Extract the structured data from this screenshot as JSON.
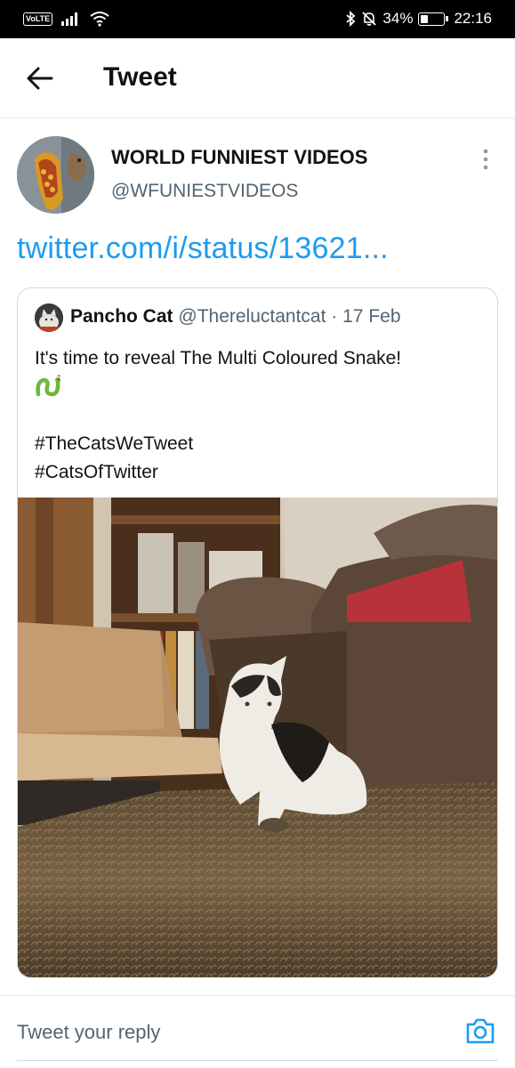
{
  "status_bar": {
    "volte_label": "VoLTE",
    "battery_percent": "34%",
    "battery_level": 0.34,
    "time": "22:16",
    "icons": [
      "signal-icon",
      "wifi-icon",
      "bluetooth-icon",
      "mute-bell-icon",
      "battery-icon"
    ]
  },
  "header": {
    "title": "Tweet",
    "back_icon": "arrow-left-icon"
  },
  "tweet": {
    "author_name": "WORLD FUNNIEST VIDEOS",
    "author_handle": "@WFUNIESTVIDEOS",
    "link_text": "twitter.com/i/status/13621...",
    "more_icon": "more-vertical-icon"
  },
  "quoted_tweet": {
    "author_name": "Pancho Cat",
    "author_handle": "@Thereluctantcat",
    "separator": "·",
    "date": "17 Feb",
    "text": "It's time to reveal The Multi Coloured Snake!",
    "emoji_icon": "snake-icon",
    "hashtag_1": "#TheCatsWeTweet",
    "hashtag_2": "#CatsOfTwitter",
    "media_type": "video"
  },
  "reply": {
    "placeholder": "Tweet your reply",
    "camera_icon": "camera-icon"
  },
  "colors": {
    "accent": "#1d9bf0",
    "text_primary": "#0f1419",
    "text_secondary": "#536471",
    "border": "#cfd9de"
  }
}
